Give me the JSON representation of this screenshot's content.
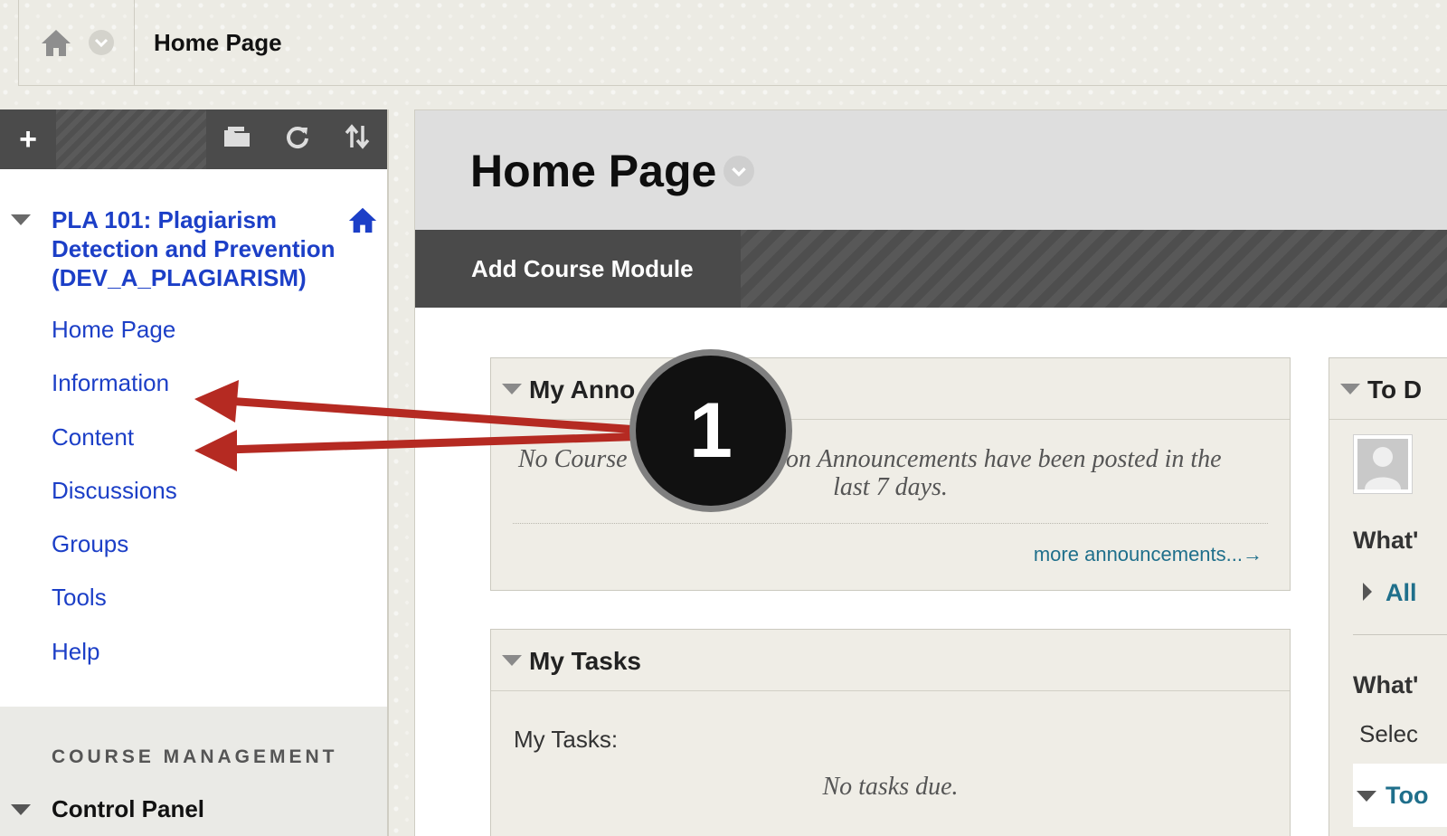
{
  "breadcrumb": {
    "title": "Home Page"
  },
  "sidebar": {
    "toolbar": {
      "add": "+"
    },
    "course_title": "PLA 101: Plagiarism Detection and Prevention (DEV_A_PLAGIARISM)",
    "items": [
      {
        "label": "Home Page"
      },
      {
        "label": "Information"
      },
      {
        "label": "Content"
      },
      {
        "label": "Discussions"
      },
      {
        "label": "Groups"
      },
      {
        "label": "Tools"
      },
      {
        "label": "Help"
      }
    ],
    "management": {
      "title": "COURSE MANAGEMENT",
      "control_panel": "Control Panel"
    }
  },
  "main": {
    "title": "Home Page",
    "add_module": "Add Course Module",
    "announcements": {
      "title": "My Anno",
      "message_left": "No Course",
      "message_right": "on Announcements have been posted in the",
      "message_line2": "last 7 days.",
      "more": "more announcements...→"
    },
    "tasks": {
      "title": "My Tasks",
      "label": "My Tasks:",
      "empty": "No tasks due."
    },
    "right_column": {
      "title": "To D",
      "whats1": "What'",
      "all": "All",
      "whats2": "What'",
      "select": "Selec",
      "too": "Too"
    }
  },
  "annotation": {
    "number": "1",
    "arrow_color": "#b52a22"
  }
}
